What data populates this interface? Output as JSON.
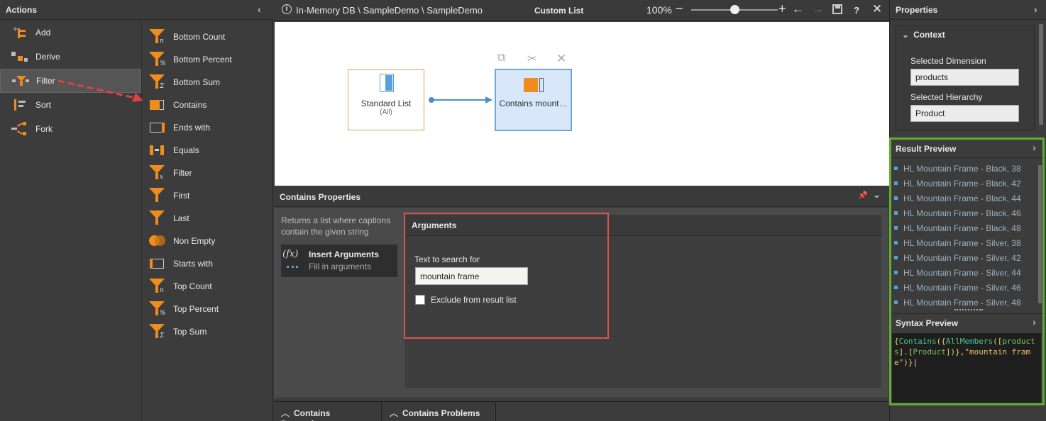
{
  "actions_panel": {
    "title": "Actions",
    "items": [
      {
        "label": "Add",
        "icon": "add-icon"
      },
      {
        "label": "Derive",
        "icon": "derive-icon"
      },
      {
        "label": "Filter",
        "icon": "filter-icon",
        "selected": true
      },
      {
        "label": "Sort",
        "icon": "sort-icon"
      },
      {
        "label": "Fork",
        "icon": "fork-icon"
      }
    ],
    "functions": [
      {
        "label": "Bottom Count",
        "icon": "funnel-n-icon"
      },
      {
        "label": "Bottom Percent",
        "icon": "funnel-percent-icon"
      },
      {
        "label": "Bottom Sum",
        "icon": "funnel-sigma-icon"
      },
      {
        "label": "Contains",
        "icon": "contains-icon"
      },
      {
        "label": "Ends with",
        "icon": "ends-with-icon"
      },
      {
        "label": "Equals",
        "icon": "equals-icon"
      },
      {
        "label": "Filter",
        "icon": "funnel-x-icon"
      },
      {
        "label": "First",
        "icon": "funnel-icon"
      },
      {
        "label": "Last",
        "icon": "funnel-icon"
      },
      {
        "label": "Non Empty",
        "icon": "non-empty-icon"
      },
      {
        "label": "Starts with",
        "icon": "starts-with-icon"
      },
      {
        "label": "Top Count",
        "icon": "funnel-n-icon"
      },
      {
        "label": "Top Percent",
        "icon": "funnel-percent-icon"
      },
      {
        "label": "Top Sum",
        "icon": "funnel-sigma-icon"
      }
    ]
  },
  "toolbar": {
    "breadcrumb": "In-Memory DB \\ SampleDemo \\ SampleDemo",
    "title": "Custom List",
    "zoom": "100%",
    "zoom_level": 0.5
  },
  "canvas": {
    "node1": {
      "title": "Standard List",
      "subtitle": "(All)"
    },
    "node2": {
      "title": "Contains mount…"
    }
  },
  "properties_section": {
    "title": "Contains Properties",
    "description": "Returns a list where captions contain the given string",
    "insert_title": "Insert Arguments",
    "insert_subtitle": "Fill in arguments",
    "arguments_title": "Arguments",
    "search_label": "Text to search for",
    "search_value": "mountain frame",
    "exclude_label": "Exclude from result list",
    "exclude_checked": false
  },
  "bottom_tabs": [
    "Contains Properties",
    "Contains Problems"
  ],
  "right_panel": {
    "title": "Properties",
    "context_title": "Context",
    "dimension_label": "Selected Dimension",
    "dimension_value": "products",
    "hierarchy_label": "Selected Hierarchy",
    "hierarchy_value": "Product",
    "result_title": "Result Preview",
    "results": [
      "HL Mountain Frame - Black, 38",
      "HL Mountain Frame - Black, 42",
      "HL Mountain Frame - Black, 44",
      "HL Mountain Frame - Black, 46",
      "HL Mountain Frame - Black, 48",
      "HL Mountain Frame - Silver, 38",
      "HL Mountain Frame - Silver, 42",
      "HL Mountain Frame - Silver, 44",
      "HL Mountain Frame - Silver, 46",
      "HL Mountain Frame - Silver, 48"
    ],
    "syntax_title": "Syntax Preview",
    "syntax": "{Contains({AllMembers([products].[Product])},\"mountain frame\")}"
  },
  "colors": {
    "accent_orange": "#f08c1e",
    "highlight_green": "#5fae2e",
    "highlight_red": "#d9534f",
    "node_blue": "#5aa0d8"
  }
}
